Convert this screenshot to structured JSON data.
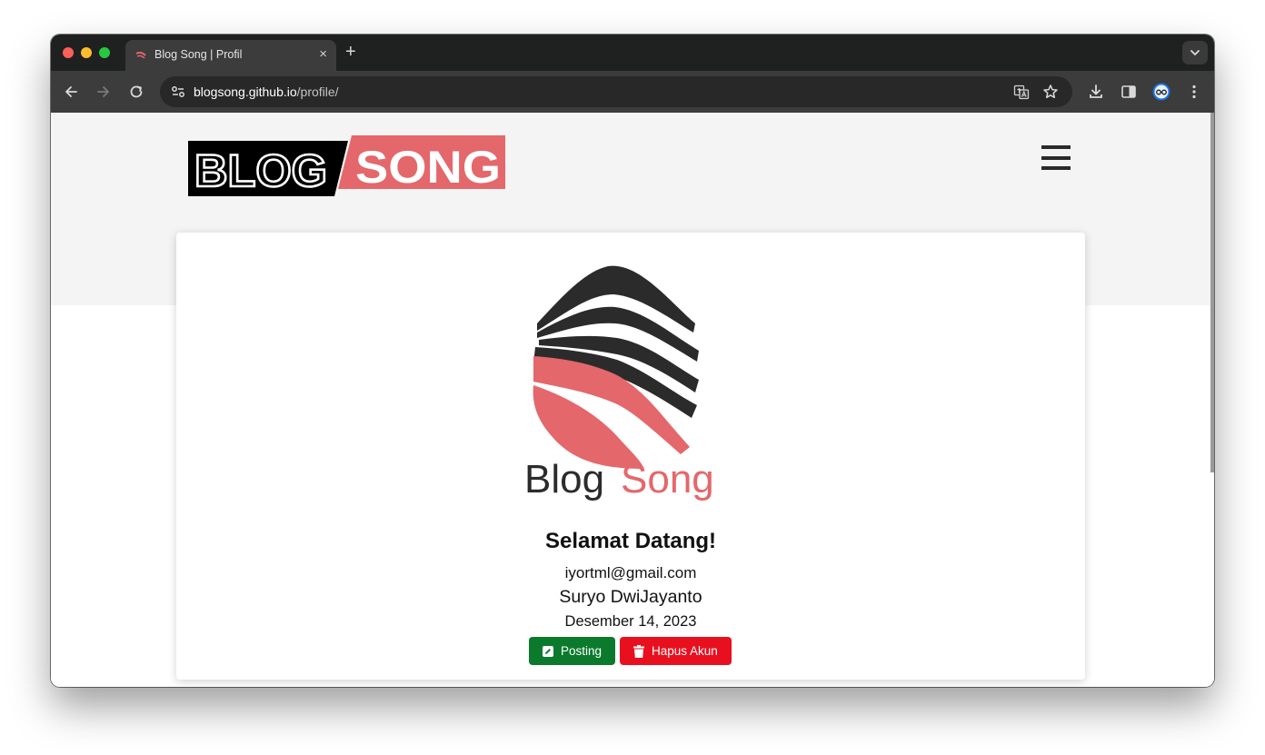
{
  "browser": {
    "tab_title": "Blog Song | Profil",
    "tab_close_icon": "×",
    "new_tab_icon": "+",
    "url_host": "blogsong.github.io",
    "url_path": "/profile/"
  },
  "site": {
    "header_logo_text_left": "BLOG",
    "header_logo_text_right": "SONG",
    "brand_name_left": "Blog",
    "brand_name_right": "Song",
    "accent_color": "#e4676b"
  },
  "profile": {
    "greeting": "Selamat Datang!",
    "email": "iyortml@gmail.com",
    "name": "Suryo DwiJayanto",
    "joined": "Desember 14, 2023"
  },
  "actions": {
    "post_label": "Posting",
    "delete_label": "Hapus Akun",
    "post_color": "#0b7a2d",
    "delete_color": "#e8101f"
  }
}
